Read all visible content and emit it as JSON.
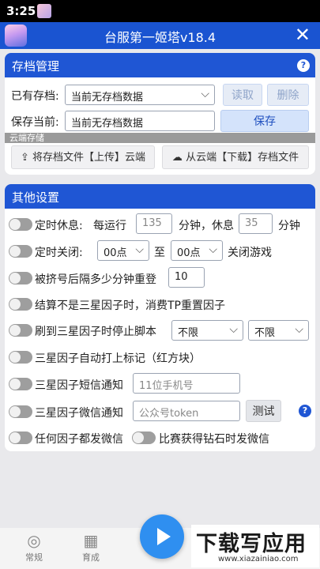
{
  "status_bar": {
    "time": "3:25"
  },
  "title_bar": {
    "title": "台服第一姬塔v18.4",
    "close_icon": "close-icon"
  },
  "save_panel": {
    "header": "存档管理",
    "existing_label": "已有存档:",
    "existing_value": "当前无存档数据",
    "read_button": "读取",
    "delete_button": "删除",
    "save_current_label": "保存当前:",
    "save_current_value": "当前无存档数据",
    "save_button": "保存",
    "cloud_label": "云端存储",
    "upload_button": "将存档文件【上传】云端",
    "download_button": "从云端【下载】存档文件"
  },
  "other_settings": {
    "header": "其他设置",
    "timed_rest": {
      "label": "定时休息:",
      "every_run": "每运行",
      "run_minutes": "135",
      "minutes_rest": "分钟，休息",
      "rest_minutes": "35",
      "minutes": "分钟"
    },
    "timed_close": {
      "label": "定时关闭:",
      "from_value": "00点",
      "to_label": "至",
      "to_value": "00点",
      "suffix": "关闭游戏"
    },
    "relogin": {
      "label": "被挤号后隔多少分钟重登",
      "value": "10"
    },
    "reset_factor": {
      "label": "结算不是三星因子时，消费TP重置因子"
    },
    "stop_script": {
      "label": "刷到三星因子时停止脚本",
      "select1": "不限",
      "select2": "不限"
    },
    "auto_mark": {
      "label": "三星因子自动打上标记（红方块）"
    },
    "sms_notify": {
      "label": "三星因子短信通知",
      "placeholder": "11位手机号"
    },
    "wechat_notify": {
      "label": "三星因子微信通知",
      "placeholder": "公众号token",
      "test_button": "测试"
    },
    "any_factor_wechat": {
      "label": "任何因子都发微信"
    },
    "diamond_wechat": {
      "label": "比赛获得钻石时发微信"
    }
  },
  "bottom_nav": {
    "items": [
      {
        "label": "常规",
        "icon": "chrome-icon"
      },
      {
        "label": "育成",
        "icon": "grid-icon"
      }
    ],
    "play_icon": "play-icon"
  },
  "watermark": {
    "main": "下载写应用",
    "url": "www.xiazainiao.com"
  },
  "colors": {
    "primary": "#1f56d4",
    "toggle_off": "#9e9e9e",
    "play": "#2f8ff0"
  }
}
